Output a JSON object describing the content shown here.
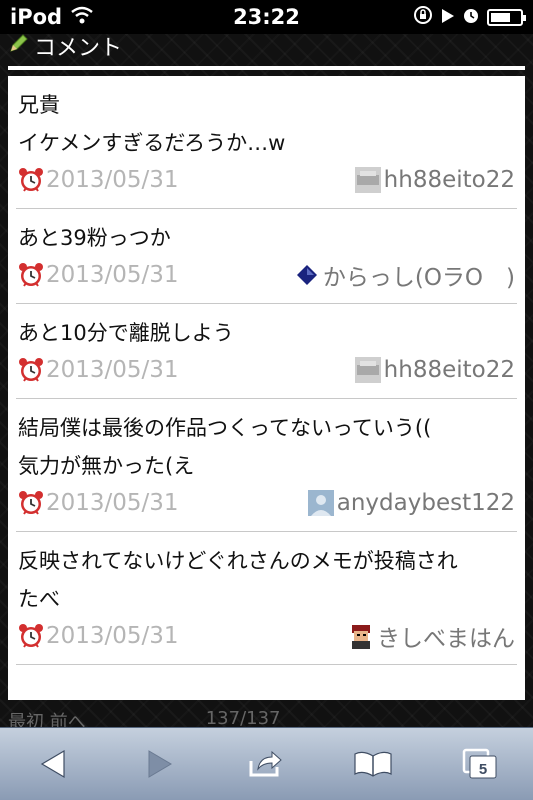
{
  "status_bar": {
    "carrier": "iPod",
    "time": "23:22"
  },
  "section": {
    "title": "コメント"
  },
  "comments": [
    {
      "text_lines": [
        "兄貴",
        "イケメンすぎるだろうか…w"
      ],
      "date": "2013/05/31",
      "user": "hh88eito22",
      "avatar_icon": "avatar-grey-blur-icon"
    },
    {
      "text_lines": [
        "あと39粉っつか"
      ],
      "date": "2013/05/31",
      "user": "からっし(OラO　)",
      "avatar_icon": "avatar-blue-diamond-icon"
    },
    {
      "text_lines": [
        "あと10分で離脱しよう"
      ],
      "date": "2013/05/31",
      "user": "hh88eito22",
      "avatar_icon": "avatar-grey-blur-icon"
    },
    {
      "text_lines": [
        "結局僕は最後の作品つくってないっていう((",
        "気力が無かった(え"
      ],
      "date": "2013/05/31",
      "user": "anydaybest122",
      "avatar_icon": "avatar-default-person-icon"
    },
    {
      "text_lines": [
        "反映されてないけどぐれさんのメモが投稿され",
        "たべ"
      ],
      "date": "2013/05/31",
      "user": "きしべまはん",
      "avatar_icon": "avatar-character-icon"
    }
  ],
  "footer_peek": {
    "left": "最初 前へ",
    "right": "137/137"
  },
  "toolbar": {
    "tabs_count": "5"
  },
  "colors": {
    "toolbar_top": "#c5d0de",
    "toolbar_bottom": "#8a9bb4",
    "date_text": "#b5b5b5",
    "user_text": "#777777"
  }
}
